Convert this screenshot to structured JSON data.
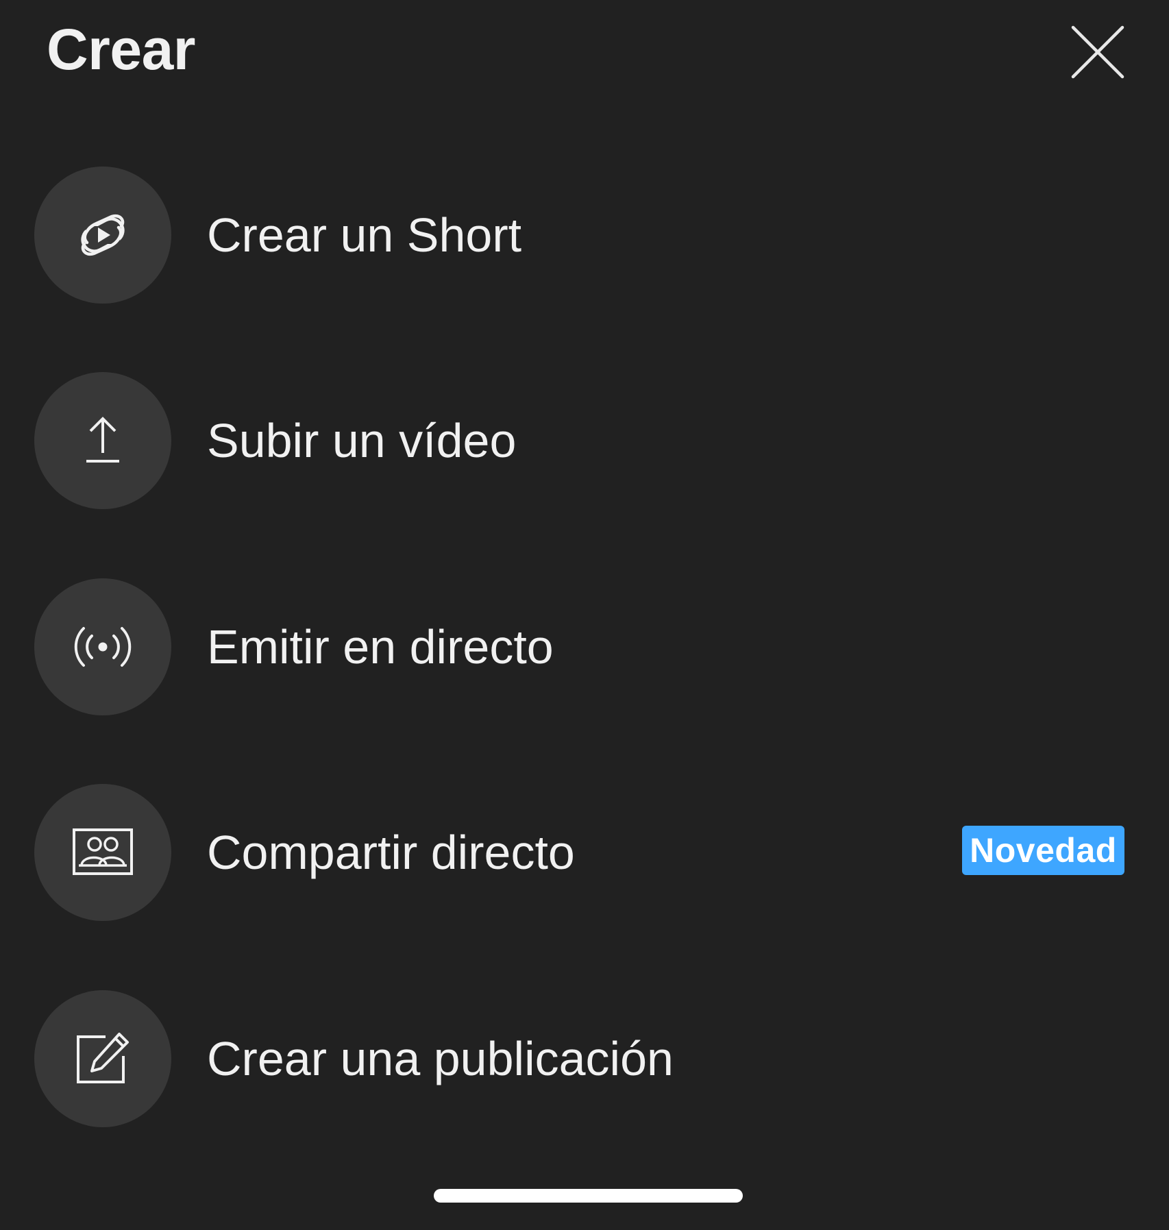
{
  "header": {
    "title": "Crear",
    "close_icon": "close-icon"
  },
  "menu": {
    "items": [
      {
        "label": "Crear un Short",
        "icon": "shorts-icon"
      },
      {
        "label": "Subir un vídeo",
        "icon": "upload-icon"
      },
      {
        "label": "Emitir en directo",
        "icon": "live-broadcast-icon"
      },
      {
        "label": "Compartir directo",
        "icon": "share-live-icon",
        "badge": "Novedad"
      },
      {
        "label": "Crear una publicación",
        "icon": "edit-post-icon"
      }
    ]
  },
  "colors": {
    "background": "#212121",
    "icon_circle": "#383838",
    "text": "#f1f1f1",
    "badge": "#3ea6ff"
  }
}
